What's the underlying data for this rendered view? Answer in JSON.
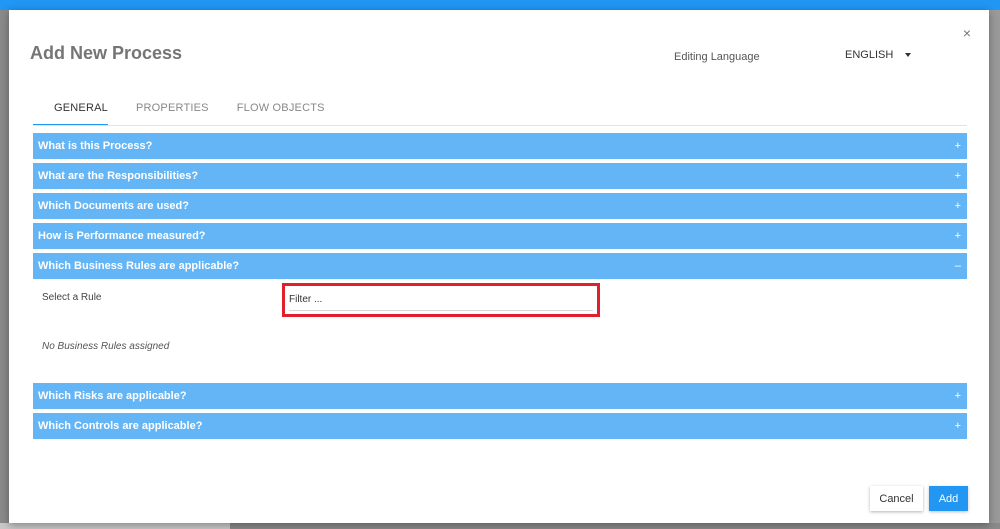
{
  "dialog": {
    "title": "Add New Process",
    "close_symbol": "×",
    "editing_language_label": "Editing Language",
    "language_value": "ENGLISH"
  },
  "tabs": [
    {
      "label": "GENERAL",
      "active": true
    },
    {
      "label": "PROPERTIES",
      "active": false
    },
    {
      "label": "FLOW OBJECTS",
      "active": false
    }
  ],
  "sections": [
    {
      "label": "What is this Process?",
      "sign": "+"
    },
    {
      "label": "What are the Responsibilities?",
      "sign": "+"
    },
    {
      "label": "Which Documents are used?",
      "sign": "+"
    },
    {
      "label": "How is Performance measured?",
      "sign": "+"
    },
    {
      "label": "Which Business Rules are applicable?",
      "sign": "–"
    },
    {
      "label": "Which Risks are applicable?",
      "sign": "+"
    },
    {
      "label": "Which Controls are applicable?",
      "sign": "+"
    }
  ],
  "business_rules": {
    "select_label": "Select a Rule",
    "filter_placeholder": "Filter ...",
    "empty_text": "No Business Rules assigned"
  },
  "footer": {
    "cancel_label": "Cancel",
    "add_label": "Add"
  },
  "colors": {
    "accent": "#2196f3",
    "section_header": "#64b5f6",
    "highlight": "#e0202b"
  },
  "icons": {
    "close": "close-icon",
    "dropdown": "caret-down-icon",
    "expand": "plus-icon",
    "collapse": "minus-icon"
  }
}
